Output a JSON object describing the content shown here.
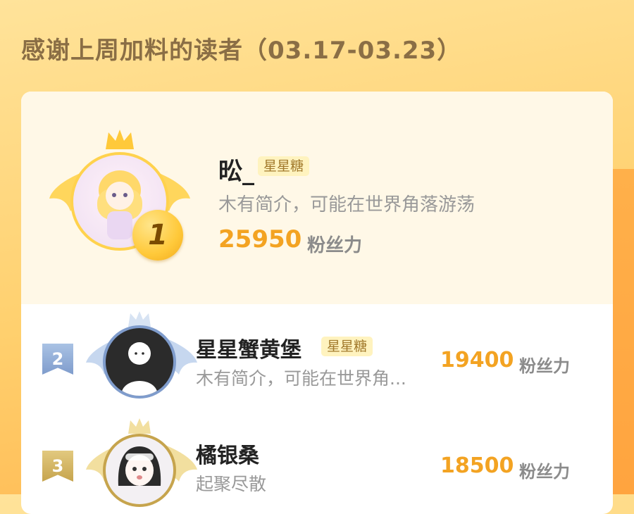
{
  "header": {
    "title": "感谢上周加料的读者（03.17-03.23）"
  },
  "ranking": [
    {
      "rank": "1",
      "name": "昖_",
      "badge": "星星糖",
      "bio": "木有简介，可能在世界角落游荡",
      "score": "25950",
      "score_unit": "粉丝力"
    },
    {
      "rank": "2",
      "name": "星星蟹黄堡",
      "badge": "星星糖",
      "bio": "木有简介，可能在世界角...",
      "score": "19400",
      "score_unit": "粉丝力"
    },
    {
      "rank": "3",
      "name": "橘银桑",
      "bio": "起聚尽散",
      "score": "18500",
      "score_unit": "粉丝力"
    }
  ],
  "colors": {
    "accent": "#f3a322",
    "gold": "#ffd24d",
    "silver": "#9bb4d4",
    "bronze": "#d8b76a"
  }
}
